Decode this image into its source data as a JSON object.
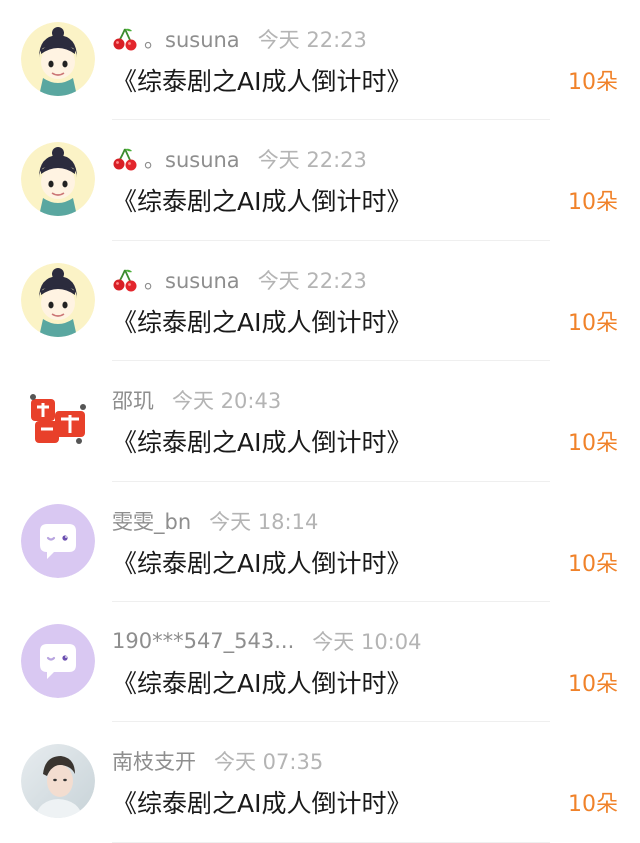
{
  "items": [
    {
      "avatar": "cartoon-boy-avatar",
      "name": "。susuna",
      "has_cherry": true,
      "time": "今天 22:23",
      "title": "《综泰剧之AI成人倒计时》",
      "gift": "10朵"
    },
    {
      "avatar": "cartoon-boy-avatar",
      "name": "。susuna",
      "has_cherry": true,
      "time": "今天 22:23",
      "title": "《综泰剧之AI成人倒计时》",
      "gift": "10朵"
    },
    {
      "avatar": "cartoon-boy-avatar",
      "name": "。susuna",
      "has_cherry": true,
      "time": "今天 22:23",
      "title": "《综泰剧之AI成人倒计时》",
      "gift": "10朵"
    },
    {
      "avatar": "red-lucky-character-avatar",
      "name": "邵玑",
      "has_cherry": false,
      "time": "今天 20:43",
      "title": "《综泰剧之AI成人倒计时》",
      "gift": "10朵"
    },
    {
      "avatar": "purple-chat-bubble-avatar",
      "name": "雯雯_bn",
      "has_cherry": false,
      "time": "今天 18:14",
      "title": "《综泰剧之AI成人倒计时》",
      "gift": "10朵"
    },
    {
      "avatar": "purple-chat-bubble-avatar",
      "name": "190***547_543...",
      "has_cherry": false,
      "time": "今天 10:04",
      "title": "《综泰剧之AI成人倒计时》",
      "gift": "10朵"
    },
    {
      "avatar": "photo-portrait-avatar",
      "name": "南枝支开",
      "has_cherry": false,
      "time": "今天 07:35",
      "title": "《综泰剧之AI成人倒计时》",
      "gift": "10朵"
    }
  ],
  "colors": {
    "gift": "#f0822a",
    "name": "#8e8e8e",
    "time": "#b4b4b4",
    "title": "#1a1a1a",
    "purple_avatar": "#d9c8f2"
  }
}
